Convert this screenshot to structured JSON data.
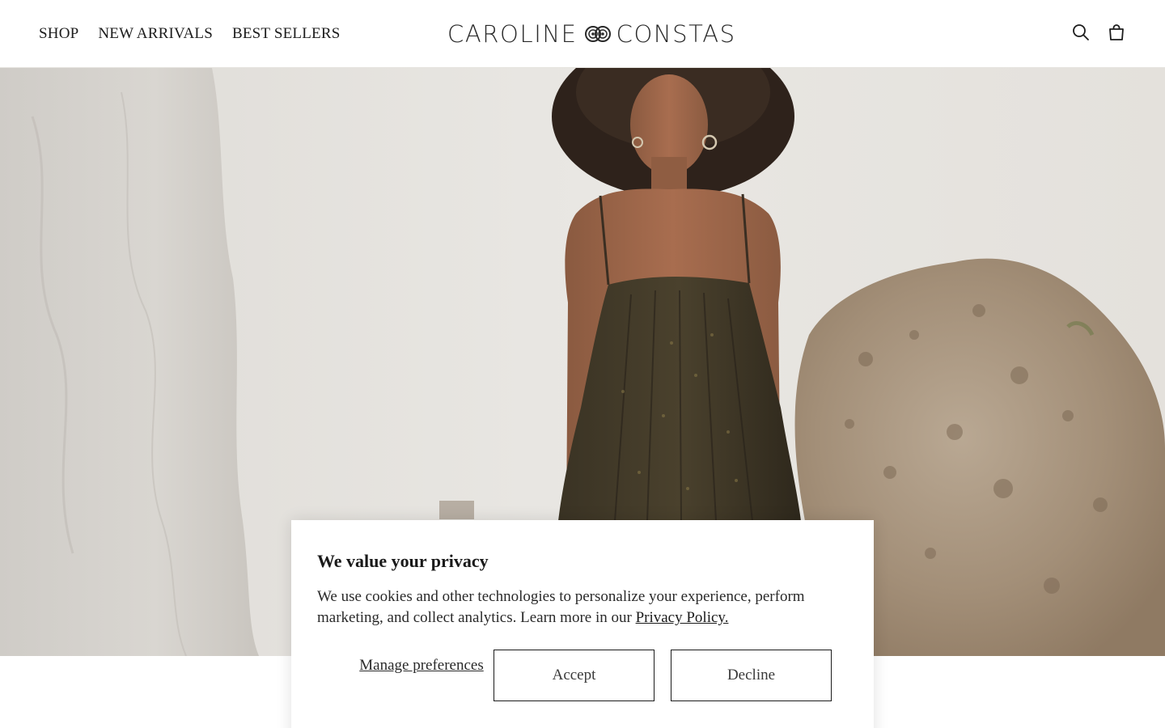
{
  "header": {
    "nav": [
      {
        "label": "SHOP"
      },
      {
        "label": "NEW ARRIVALS"
      },
      {
        "label": "BEST SELLERS"
      }
    ],
    "logo_left": "CAROLINE",
    "logo_right": "CONSTAS",
    "icons": [
      "search-icon",
      "bag-icon"
    ]
  },
  "hero": {
    "image": "model-in-dark-sequin-slip-dress-photo"
  },
  "cookie": {
    "title": "We value your privacy",
    "body": "We use cookies and other technologies to personalize your experience, perform marketing, and collect analytics. Learn more in our ",
    "policy_link": "Privacy Policy.",
    "manage_label": "Manage preferences",
    "accept_label": "Accept",
    "decline_label": "Decline"
  },
  "colors": {
    "text": "#1c1c1c",
    "background": "#ffffff",
    "hero_wall": "#e7e4df"
  }
}
